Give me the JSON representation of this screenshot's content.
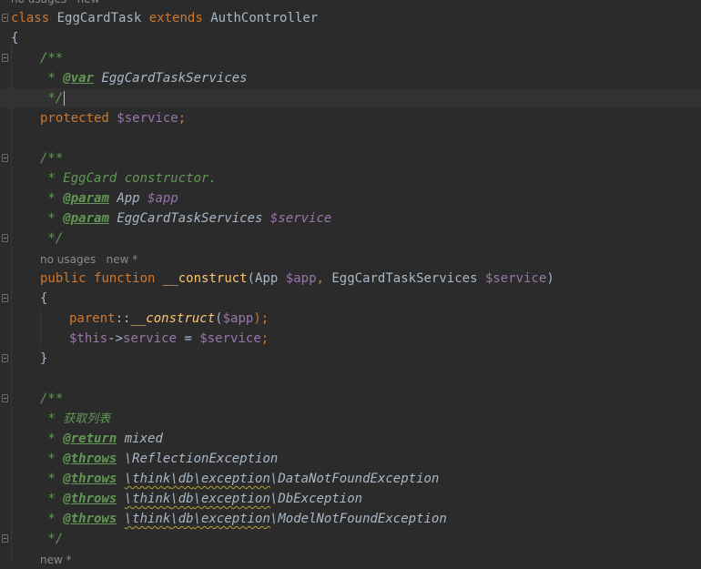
{
  "hints": {
    "top": "no usages   new *",
    "construct": "no usages   new *",
    "bottom": "new *"
  },
  "tokens": {
    "class_kw": "class",
    "class_name": "EggCardTask",
    "extends_kw": "extends",
    "parent_class": "AuthController",
    "brace_open": "{",
    "brace_close": "}",
    "doc_open": "/**",
    "doc_star": " * ",
    "doc_close": " */",
    "tag_var": "@var",
    "var_type": "EggCardTaskServices",
    "protected_kw": "protected",
    "service_var": "$service",
    "semicolon": ";",
    "doc_desc": "EggCard constructor.",
    "tag_param": "@param",
    "param1_type": "App",
    "param1_var": "$app",
    "param2_type": "EggCardTaskServices",
    "param2_var": "$service",
    "public_kw": "public",
    "function_kw": "function",
    "construct_name": "__construct",
    "paren_open": "(",
    "paren_close": ")",
    "arg_type1": "App",
    "arg_var1": "$app",
    "comma": ", ",
    "arg_type2": "EggCardTaskServices",
    "arg_var2": "$service",
    "parent_kw": "parent",
    "scope_op": "::",
    "parent_construct": "__construct",
    "parent_arg": "$app",
    "close_paren_semi": ");",
    "this_kw": "$this",
    "arrow_op": "->",
    "prop_service": "service",
    "assign_op": " = ",
    "assign_val": "$service",
    "doc2_desc": "获取列表",
    "tag_return": "@return",
    "return_type": "mixed",
    "tag_throws": "@throws",
    "throws1": "\\ReflectionException",
    "throws2_ns_a": "\\think",
    "throws2_ns_b": "\\db",
    "throws2_ns_c": "\\exception",
    "throws2_cls": "\\DataNotFoundException",
    "throws3_cls": "\\DbException",
    "throws4_cls": "\\ModelNotFoundException"
  }
}
